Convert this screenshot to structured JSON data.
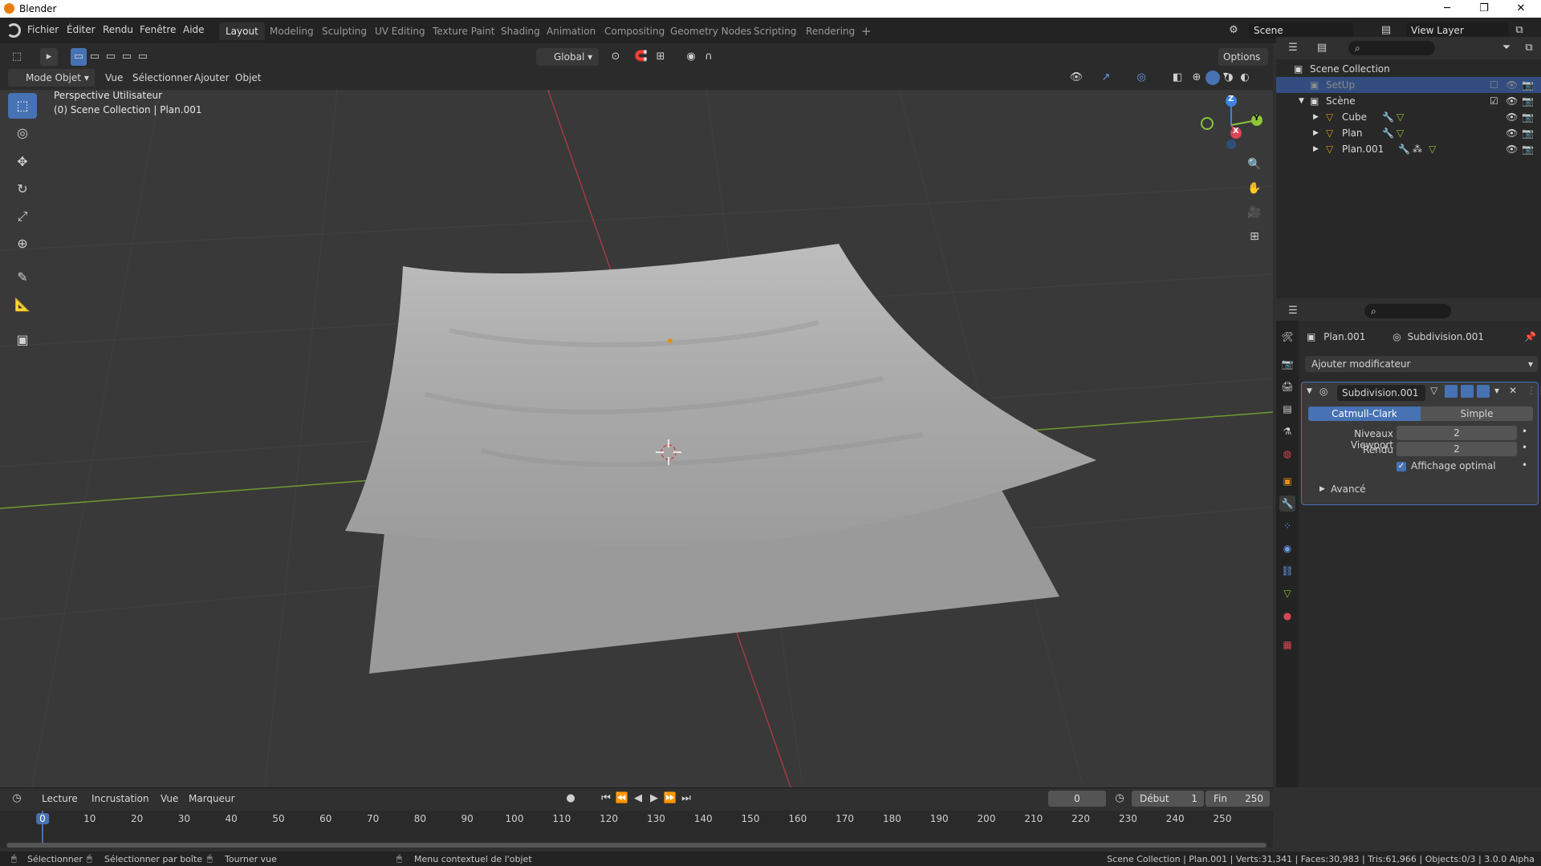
{
  "titlebar": {
    "title": "Blender",
    "minimize": "─",
    "maximize": "❐",
    "close": "✕"
  },
  "menu": {
    "items": [
      "Fichier",
      "Éditer",
      "Rendu",
      "Fenêtre",
      "Aide"
    ]
  },
  "workspaces": {
    "tabs": [
      "Layout",
      "Modeling",
      "Sculpting",
      "UV Editing",
      "Texture Paint",
      "Shading",
      "Animation",
      "Compositing",
      "Geometry Nodes",
      "Scripting",
      "Rendering"
    ],
    "active": "Layout",
    "add": "+"
  },
  "scene": {
    "name": "Scene",
    "view_layer": "View Layer"
  },
  "viewport_header": {
    "mode": "Mode Objet",
    "menus": [
      "Vue",
      "Sélectionner",
      "Ajouter",
      "Objet"
    ],
    "orientation": "Global",
    "options": "Options"
  },
  "viewport": {
    "perspective": "Perspective Utilisateur",
    "collection_info": "(0) Scene Collection | Plan.001"
  },
  "gizmo": {
    "x": "X",
    "y": "Y",
    "z": "Z"
  },
  "outliner": {
    "root": "Scene Collection",
    "items": [
      {
        "label": "SetUp"
      },
      {
        "label": "Scène"
      },
      {
        "label": "Cube"
      },
      {
        "label": "Plan"
      },
      {
        "label": "Plan.001"
      }
    ]
  },
  "properties": {
    "object": "Plan.001",
    "modifier_name_crumb": "Subdivision.001",
    "add_modifier": "Ajouter modificateur",
    "modifier": {
      "name": "Subdivision.001",
      "type_a": "Catmull-Clark",
      "type_b": "Simple",
      "viewport_label": "Niveaux Viewport",
      "viewport_value": "2",
      "render_label": "Rendu",
      "render_value": "2",
      "optimal_label": "Affichage optimal",
      "advanced": "Avancé"
    }
  },
  "timeline": {
    "menus": [
      "Lecture",
      "Incrustation",
      "Vue",
      "Marqueur"
    ],
    "current_frame": "0",
    "start_label": "Début",
    "start": "1",
    "end_label": "Fin",
    "end": "250",
    "ticks": [
      "0",
      "10",
      "20",
      "30",
      "40",
      "50",
      "60",
      "70",
      "80",
      "90",
      "100",
      "110",
      "120",
      "130",
      "140",
      "150",
      "160",
      "170",
      "180",
      "190",
      "200",
      "210",
      "220",
      "230",
      "240",
      "250"
    ]
  },
  "statusbar": {
    "select": "Sélectionner",
    "box_select": "Sélectionner par boîte",
    "rotate": "Tourner vue",
    "context": "Menu contextuel de l'objet",
    "stats": "Scene Collection | Plan.001 | Verts:31,341 | Faces:30,983 | Tris:61,966 | Objects:0/3 | 3.0.0 Alpha"
  },
  "colors": {
    "accent": "#4772b3",
    "orange": "#e87d0d",
    "x_axis": "#d94656",
    "y_axis": "#8cc43a",
    "z_axis": "#3a84e8"
  }
}
